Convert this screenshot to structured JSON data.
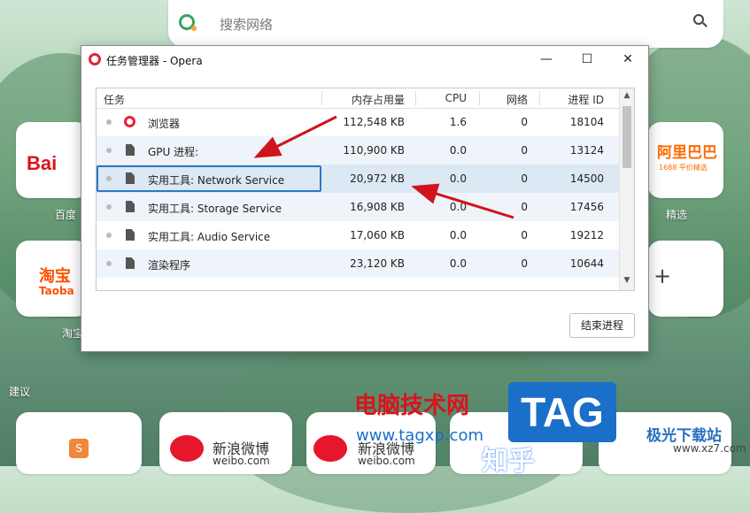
{
  "search": {
    "placeholder": "搜索网络"
  },
  "speed_dial": {
    "baidu_logo": "Bai",
    "baidu_label": "百度",
    "taobao_logo": "淘宝",
    "taobao_sub": "Taoba",
    "taobao_label": "淘宝",
    "alibaba_logo": "阿里巴巴",
    "alibaba_sub": "1688 平价精选",
    "alibaba_label": "精选",
    "add_label": "+",
    "section_label": "建议",
    "weibo_1": "新浪微博",
    "weibo_1_url": "weibo.com",
    "weibo_2": "新浪微博",
    "weibo_2_url": "weibo.com",
    "s_label": "S",
    "zhi_label": "知乎"
  },
  "window": {
    "title": "任务管理器 - Opera",
    "controls": {
      "minimize": "—",
      "maximize": "☐",
      "close": "✕"
    },
    "columns": {
      "task": "任务",
      "memory": "内存占用量",
      "cpu": "CPU",
      "network": "网络",
      "pid": "进程 ID"
    },
    "rows": [
      {
        "icon": "opera-icon",
        "task": "浏览器",
        "memory": "112,548 KB",
        "cpu": "1.6",
        "network": "0",
        "pid": "18104"
      },
      {
        "icon": "file-icon",
        "task": "GPU 进程:",
        "memory": "110,900 KB",
        "cpu": "0.0",
        "network": "0",
        "pid": "13124"
      },
      {
        "icon": "file-icon",
        "task": "实用工具: Network Service",
        "memory": "20,972 KB",
        "cpu": "0.0",
        "network": "0",
        "pid": "14500"
      },
      {
        "icon": "file-icon",
        "task": "实用工具: Storage Service",
        "memory": "16,908 KB",
        "cpu": "0.0",
        "network": "0",
        "pid": "17456"
      },
      {
        "icon": "file-icon",
        "task": "实用工具: Audio Service",
        "memory": "17,060 KB",
        "cpu": "0.0",
        "network": "0",
        "pid": "19212"
      },
      {
        "icon": "file-icon",
        "task": "渲染程序",
        "memory": "23,120 KB",
        "cpu": "0.0",
        "network": "0",
        "pid": "10644"
      }
    ],
    "end_process_button": "结束进程",
    "selected_row": 2
  },
  "watermarks": {
    "site_cn": "电脑技术网",
    "site_url": "www.tagxp.com",
    "tag": "TAG",
    "jiguang": "极光下载站",
    "jiguang_url": "www.xz7.com"
  },
  "colors": {
    "accent": "#2a78c7",
    "opera_red": "#e2243b",
    "watermark_red": "#d8141c",
    "tag_blue": "#1a6fc9"
  }
}
